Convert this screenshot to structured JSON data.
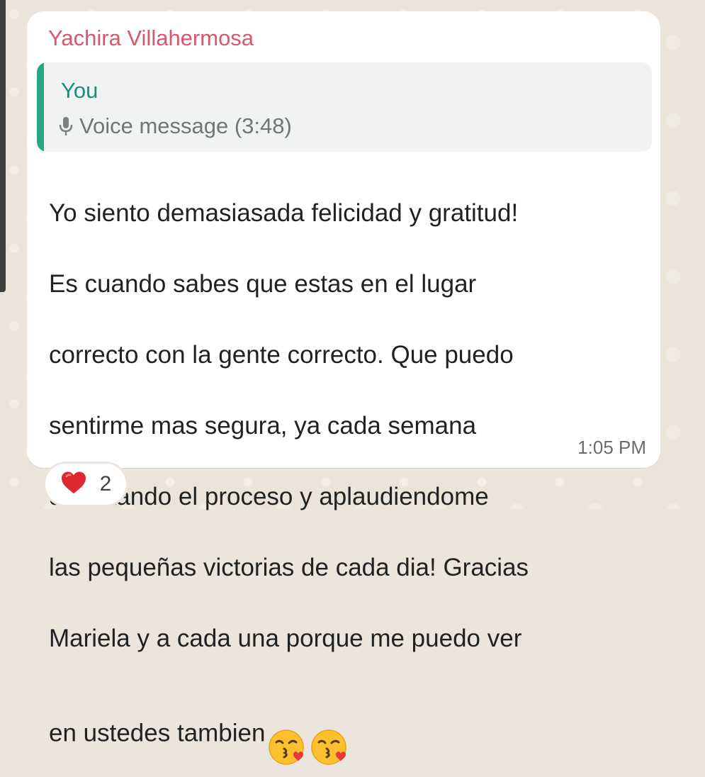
{
  "message": {
    "sender_name": "Yachira Villahermosa",
    "quoted": {
      "author": "You",
      "icon": "microphone-icon",
      "description": "Voice message (3:48)"
    },
    "text_lines": [
      "Yo siento demasiasada felicidad y gratitud!",
      "Es cuando sabes que estas en el lugar",
      "correcto con la gente correcto. Que puedo",
      "sentirme mas segura, ya cada semana",
      "disfrutando el proceso y aplaudiendome",
      "las pequeñas victorias de cada dia! Gracias",
      "Mariela y a cada una porque me puedo ver",
      "en ustedes tambien"
    ],
    "trailing_emojis": [
      "face-blowing-kiss-emoji",
      "face-blowing-kiss-emoji"
    ],
    "timestamp": "1:05 PM"
  },
  "reaction": {
    "icon": "red-heart-icon",
    "count": "2"
  },
  "colors": {
    "sender": "#d9576d",
    "quote_accent": "#25a883",
    "quote_author": "#16907d",
    "bubble": "#ffffff",
    "wallpaper": "#ebe4da"
  }
}
